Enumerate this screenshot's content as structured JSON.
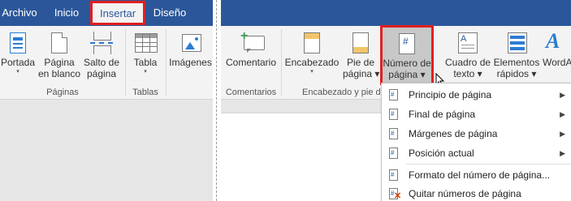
{
  "left": {
    "tabs": [
      {
        "label": "Archivo"
      },
      {
        "label": "Inicio"
      },
      {
        "label": "Insertar"
      },
      {
        "label": "Diseño"
      }
    ],
    "buttons": [
      {
        "label1": "Portada",
        "label2": "",
        "arrow": "▾"
      },
      {
        "label1": "Página",
        "label2": "en blanco"
      },
      {
        "label1": "Salto de",
        "label2": "página"
      },
      {
        "label1": "Tabla",
        "label2": "",
        "arrow": "▾"
      },
      {
        "label1": "Imágenes",
        "label2": ""
      }
    ],
    "groups": [
      "Páginas",
      "Tablas"
    ]
  },
  "right": {
    "buttons": [
      {
        "label1": "Comentario",
        "label2": ""
      },
      {
        "label1": "Encabezado",
        "label2": "",
        "arrow": "▾"
      },
      {
        "label1": "Pie de",
        "label2": "página ▾"
      },
      {
        "label1": "Número de",
        "label2": "página ▾"
      },
      {
        "label1": "Cuadro de",
        "label2": "texto ▾"
      },
      {
        "label1": "Elementos",
        "label2": "rápidos ▾"
      },
      {
        "label1": "WordA",
        "label2": ""
      }
    ],
    "groups": [
      "Comentarios",
      "Encabezado y pie de"
    ],
    "menu": {
      "items": [
        {
          "label": "Principio de página",
          "has_submenu": true
        },
        {
          "label": "Final de página",
          "has_submenu": true
        },
        {
          "label": "Márgenes de página",
          "has_submenu": true
        },
        {
          "label": "Posición actual",
          "has_submenu": true
        },
        {
          "label": "Formato del número de página...",
          "has_submenu": false
        },
        {
          "label": "Quitar números de página",
          "has_submenu": false
        }
      ],
      "submenu_arrow": "▶"
    },
    "page_number_icon_glyph": "#"
  },
  "colors": {
    "titlebar": "#2b579a",
    "ribbon": "#f3f3f3",
    "highlight_box": "#e02020",
    "icon_blue": "#2b7cd3"
  }
}
